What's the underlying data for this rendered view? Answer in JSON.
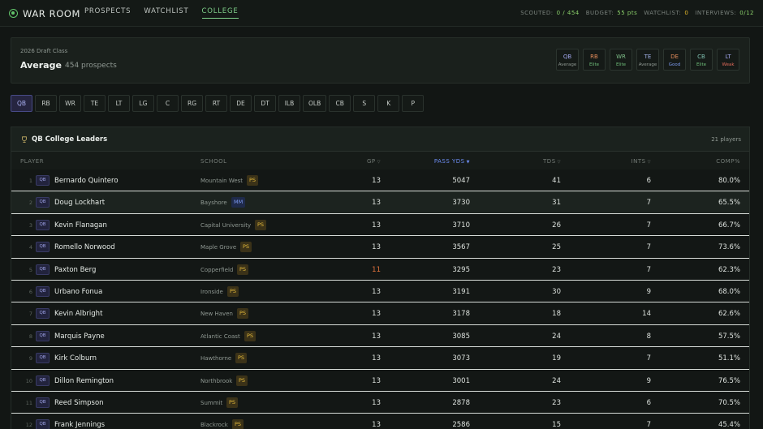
{
  "brand": "WAR ROOM",
  "nav": [
    "PROSPECTS",
    "WATCHLIST",
    "COLLEGE"
  ],
  "stats": {
    "scouted_label": "SCOUTED:",
    "scouted_value": "0 / 454",
    "budget_label": "BUDGET:",
    "budget_value": "55 pts",
    "watchlist_label": "WATCHLIST:",
    "watchlist_value": "0",
    "interviews_label": "INTERVIEWS:",
    "interviews_value": "0/12"
  },
  "class_card": {
    "label": "2026 Draft Class",
    "grade": "Average",
    "count": "454 prospects",
    "positions": [
      {
        "pos": "QB",
        "grade": "Average",
        "color": "#9da2e6",
        "grade_color": "#8f9892"
      },
      {
        "pos": "RB",
        "grade": "Elite",
        "color": "#e08a5a",
        "grade_color": "#6fbf7a"
      },
      {
        "pos": "WR",
        "grade": "Elite",
        "color": "#7fbf8a",
        "grade_color": "#6fbf7a"
      },
      {
        "pos": "TE",
        "grade": "Average",
        "color": "#a0b0e6",
        "grade_color": "#8f9892"
      },
      {
        "pos": "DE",
        "grade": "Good",
        "color": "#e08a5a",
        "grade_color": "#7d9bf0"
      },
      {
        "pos": "CB",
        "grade": "Elite",
        "color": "#7fbfb0",
        "grade_color": "#6fbf7a"
      },
      {
        "pos": "LT",
        "grade": "Weak",
        "color": "#9da2e6",
        "grade_color": "#e06a5a"
      }
    ]
  },
  "position_filter": [
    "QB",
    "RB",
    "WR",
    "TE",
    "LT",
    "LG",
    "C",
    "RG",
    "RT",
    "DE",
    "DT",
    "ILB",
    "OLB",
    "CB",
    "S",
    "K",
    "P"
  ],
  "leaders": {
    "title": "QB College Leaders",
    "count": "21 players",
    "columns": {
      "player": "PLAYER",
      "school": "SCHOOL",
      "gp": "GP",
      "pass_yds": "PASS YDS",
      "tds": "TDS",
      "ints": "INTS",
      "comp": "COMP%"
    },
    "rows": [
      {
        "rank": "1",
        "pos": "QB",
        "name": "Bernardo Quintero",
        "school": "Mountain West",
        "tag": "PS",
        "gp": "13",
        "yds": "5047",
        "tds": "41",
        "ints": "6",
        "comp": "80.0%"
      },
      {
        "rank": "2",
        "pos": "QB",
        "name": "Doug Lockhart",
        "school": "Bayshore",
        "tag": "MM",
        "gp": "13",
        "yds": "3730",
        "tds": "31",
        "ints": "7",
        "comp": "65.5%"
      },
      {
        "rank": "3",
        "pos": "QB",
        "name": "Kevin Flanagan",
        "school": "Capital University",
        "tag": "PS",
        "gp": "13",
        "yds": "3710",
        "tds": "26",
        "ints": "7",
        "comp": "66.7%"
      },
      {
        "rank": "4",
        "pos": "QB",
        "name": "Romello Norwood",
        "school": "Maple Grove",
        "tag": "PS",
        "gp": "13",
        "yds": "3567",
        "tds": "25",
        "ints": "7",
        "comp": "73.6%"
      },
      {
        "rank": "5",
        "pos": "QB",
        "name": "Paxton Berg",
        "school": "Copperfield",
        "tag": "PS",
        "gp": "11",
        "yds": "3295",
        "tds": "23",
        "ints": "7",
        "comp": "62.3%"
      },
      {
        "rank": "6",
        "pos": "QB",
        "name": "Urbano Fonua",
        "school": "Ironside",
        "tag": "PS",
        "gp": "13",
        "yds": "3191",
        "tds": "30",
        "ints": "9",
        "comp": "68.0%"
      },
      {
        "rank": "7",
        "pos": "QB",
        "name": "Kevin Albright",
        "school": "New Haven",
        "tag": "PS",
        "gp": "13",
        "yds": "3178",
        "tds": "18",
        "ints": "14",
        "comp": "62.6%"
      },
      {
        "rank": "8",
        "pos": "QB",
        "name": "Marquis Payne",
        "school": "Atlantic Coast",
        "tag": "PS",
        "gp": "13",
        "yds": "3085",
        "tds": "24",
        "ints": "8",
        "comp": "57.5%"
      },
      {
        "rank": "9",
        "pos": "QB",
        "name": "Kirk Colburn",
        "school": "Hawthorne",
        "tag": "PS",
        "gp": "13",
        "yds": "3073",
        "tds": "19",
        "ints": "7",
        "comp": "51.1%"
      },
      {
        "rank": "10",
        "pos": "QB",
        "name": "Dillon Remington",
        "school": "Northbrook",
        "tag": "PS",
        "gp": "13",
        "yds": "3001",
        "tds": "24",
        "ints": "9",
        "comp": "76.5%"
      },
      {
        "rank": "11",
        "pos": "QB",
        "name": "Reed Simpson",
        "school": "Summit",
        "tag": "PS",
        "gp": "13",
        "yds": "2878",
        "tds": "23",
        "ints": "6",
        "comp": "70.5%"
      },
      {
        "rank": "12",
        "pos": "QB",
        "name": "Frank Jennings",
        "school": "Blackrock",
        "tag": "PS",
        "gp": "13",
        "yds": "2586",
        "tds": "15",
        "ints": "7",
        "comp": "45.4%"
      }
    ]
  }
}
